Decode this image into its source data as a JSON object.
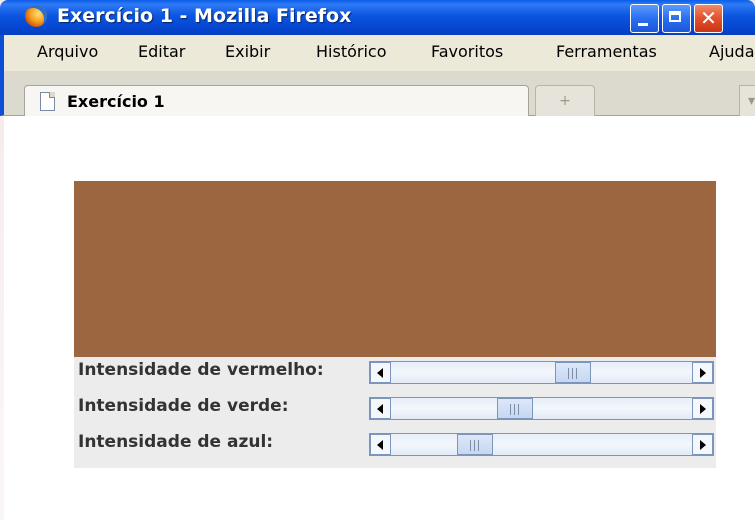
{
  "window": {
    "title": "Exercício 1 - Mozilla Firefox",
    "controls": {
      "minimize": "minimize-icon",
      "maximize": "maximize-icon",
      "close": "✕"
    }
  },
  "menubar": {
    "items": [
      "Arquivo",
      "Editar",
      "Exibir",
      "Histórico",
      "Favoritos",
      "Ferramentas",
      "Ajuda"
    ]
  },
  "tabs": {
    "active_label": "Exercício 1",
    "new_tab_symbol": "+",
    "scroll_symbol": "▾"
  },
  "applet": {
    "color_swatch": "#9c6641",
    "sliders": [
      {
        "label": "Intensidade de vermelho:",
        "value_fraction": 0.62
      },
      {
        "label": "Intensidade de verde:",
        "value_fraction": 0.4
      },
      {
        "label": "Intensidade de azul:",
        "value_fraction": 0.25
      }
    ]
  }
}
